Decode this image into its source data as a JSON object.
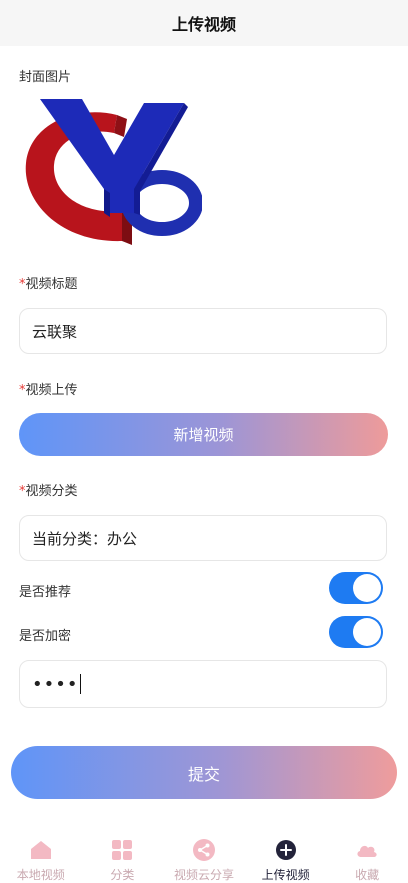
{
  "header": {
    "title": "上传视频"
  },
  "cover": {
    "label": "封面图片"
  },
  "video_title": {
    "required_mark": "*",
    "label": "视频标题",
    "value": "云联聚"
  },
  "video_upload": {
    "required_mark": "*",
    "label": "视频上传",
    "button_label": "新增视频"
  },
  "category": {
    "required_mark": "*",
    "label": "视频分类",
    "value": "当前分类：办公"
  },
  "recommend": {
    "label": "是否推荐",
    "enabled": true
  },
  "encrypt": {
    "label": "是否加密",
    "enabled": true
  },
  "password": {
    "value": "••••"
  },
  "submit": {
    "label": "提交"
  },
  "tabbar": {
    "items": [
      {
        "label": "本地视频",
        "icon": "home-icon",
        "active": false
      },
      {
        "label": "分类",
        "icon": "grid-icon",
        "active": false
      },
      {
        "label": "视频云分享",
        "icon": "share-icon",
        "active": false
      },
      {
        "label": "上传视频",
        "icon": "plus-icon",
        "active": true
      },
      {
        "label": "收藏",
        "icon": "cloud-icon",
        "active": false
      }
    ]
  },
  "colors": {
    "accent": "#1e7bf2",
    "gradient_start": "#5f95f8",
    "gradient_end": "#ee9b9a",
    "required": "#e53935"
  }
}
